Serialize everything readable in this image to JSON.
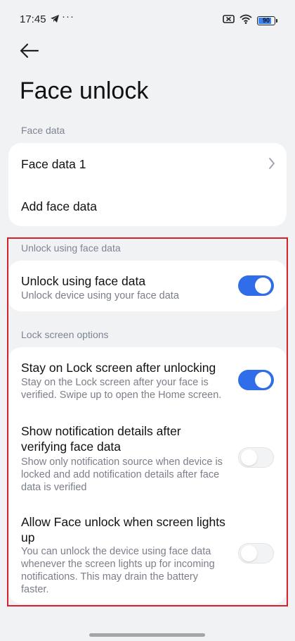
{
  "status_bar": {
    "time": "17:45",
    "dots": "···",
    "battery_level": "90",
    "icons": [
      "telegram-icon",
      "no-sim-icon",
      "wifi-icon",
      "battery-icon"
    ]
  },
  "header": {
    "back_icon": "arrow-left-icon",
    "title": "Face unlock"
  },
  "face_data": {
    "section_label": "Face data",
    "items": [
      {
        "label": "Face data 1",
        "icon": "chevron-right-icon"
      },
      {
        "label": "Add face data"
      }
    ]
  },
  "unlock": {
    "section_label": "Unlock using face data",
    "item": {
      "title": "Unlock using face data",
      "subtitle": "Unlock device using your face data",
      "enabled": true
    }
  },
  "lock_screen": {
    "section_label": "Lock screen options",
    "items": [
      {
        "title": "Stay on Lock screen after unlocking",
        "subtitle_lines": [
          "Stay on the Lock screen after your face is",
          "verified. Swipe up to open the Home screen."
        ],
        "enabled": true
      },
      {
        "title_lines": [
          "Show notification details after",
          "verifying face data"
        ],
        "subtitle_lines": [
          "Show only notification source when device is",
          "locked and add notification details after face",
          "data is verified"
        ],
        "enabled": false
      },
      {
        "title_lines": [
          "Allow Face unlock when screen lights",
          "up"
        ],
        "subtitle_lines": [
          "You can unlock the device using face data",
          "whenever the screen lights up for incoming",
          "notifications. This may drain the battery",
          "faster."
        ],
        "enabled": false
      }
    ]
  },
  "colors": {
    "accent": "#2f6ee8",
    "background": "#f1f2f4",
    "card": "#ffffff",
    "highlight_border": "#d7202c"
  }
}
